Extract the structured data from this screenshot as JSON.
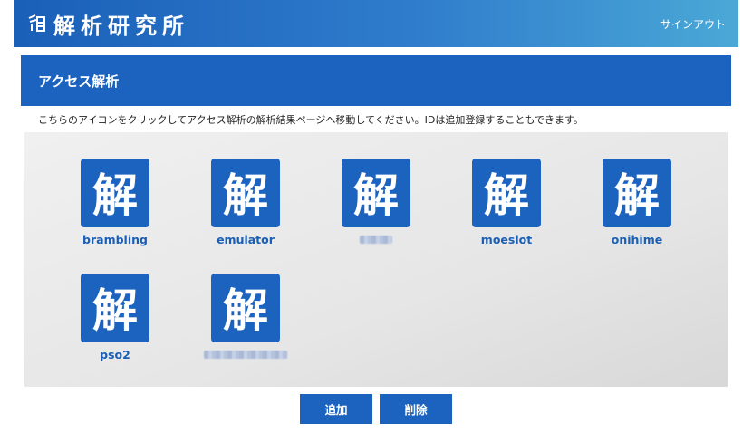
{
  "header": {
    "logo_text": "解析研究所",
    "signout_label": "サインアウト"
  },
  "section": {
    "title": "アクセス解析"
  },
  "description": "こちらのアイコンをクリックしてアクセス解析の解析結果ページへ移動してください。IDは追加登録することもできます。",
  "icon_glyph": "解",
  "sites": [
    {
      "name": "brambling",
      "redacted": false
    },
    {
      "name": "emulator",
      "redacted": false
    },
    {
      "name": "",
      "redacted": true
    },
    {
      "name": "moeslot",
      "redacted": false
    },
    {
      "name": "onihime",
      "redacted": false
    },
    {
      "name": "pso2",
      "redacted": false
    },
    {
      "name": "",
      "redacted": true
    }
  ],
  "buttons": {
    "add_label": "追加",
    "delete_label": "削除"
  },
  "colors": {
    "primary": "#1b63bf",
    "link": "#1b5fb5",
    "panel": "#e6e6e6"
  }
}
